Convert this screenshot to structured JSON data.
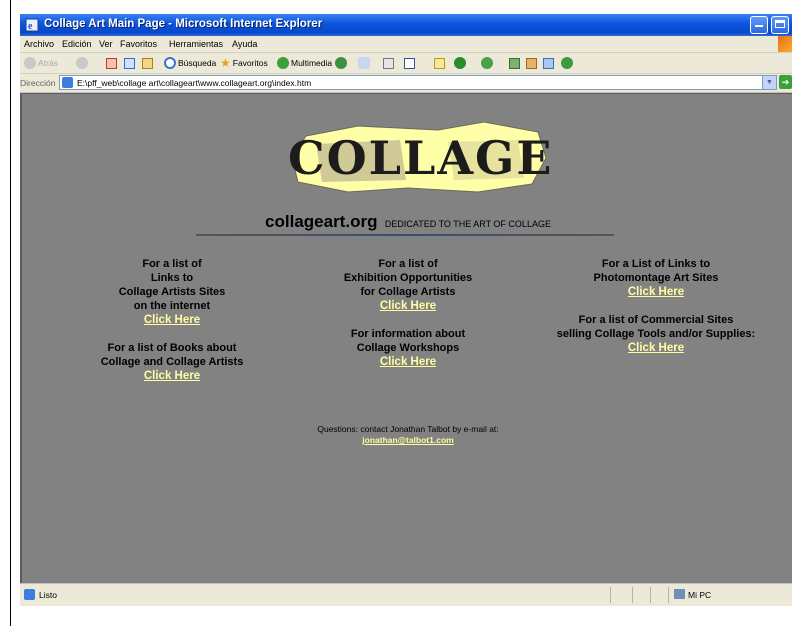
{
  "window": {
    "title": "Collage Art Main Page - Microsoft Internet Explorer"
  },
  "menu": [
    "Archivo",
    "Edición",
    "Ver",
    "Favoritos",
    "Herramientas",
    "Ayuda"
  ],
  "toolbar": {
    "back": "Atrás",
    "search": "Búsqueda",
    "favorites": "Favoritos",
    "multimedia": "Multimedia"
  },
  "address": {
    "label": "Dirección",
    "url": "E:\\pff_web\\collage art\\collageart\\www.collageart.org\\index.htm",
    "go": "Ir"
  },
  "page": {
    "logo_text": "COLLAGE",
    "site_name": "collageart.org",
    "tagline": "DEDICATED TO THE ART OF COLLAGE",
    "left": {
      "block1": [
        "For a list of",
        "Links to",
        "Collage Artists Sites",
        "on the internet"
      ],
      "block1_link": "Click Here",
      "block2": [
        "For a list of Books about",
        "Collage and Collage Artists"
      ],
      "block2_link": "Click Here"
    },
    "middle": {
      "block1": [
        "For a list of",
        "Exhibition Opportunities",
        "for Collage Artists"
      ],
      "block1_link": "Click Here",
      "block2": [
        "For information about",
        "Collage Workshops"
      ],
      "block2_link": "Click Here"
    },
    "right": {
      "block1": [
        "For a List of Links to",
        "Photomontage Art Sites"
      ],
      "block1_link": "Click Here",
      "block2": [
        "For a list of Commercial Sites",
        "selling Collage Tools and/or Supplies:"
      ],
      "block2_link": "Click Here"
    },
    "contact_text": "Questions: contact Jonathan Talbot by e-mail at:",
    "contact_email": "jonathan@talbot1.com"
  },
  "status": {
    "text": "Listo",
    "zone": "Mi PC"
  },
  "colors": {
    "page_background": "#828282",
    "link": "#ffffa0",
    "titlebar": "#0a55dd"
  }
}
